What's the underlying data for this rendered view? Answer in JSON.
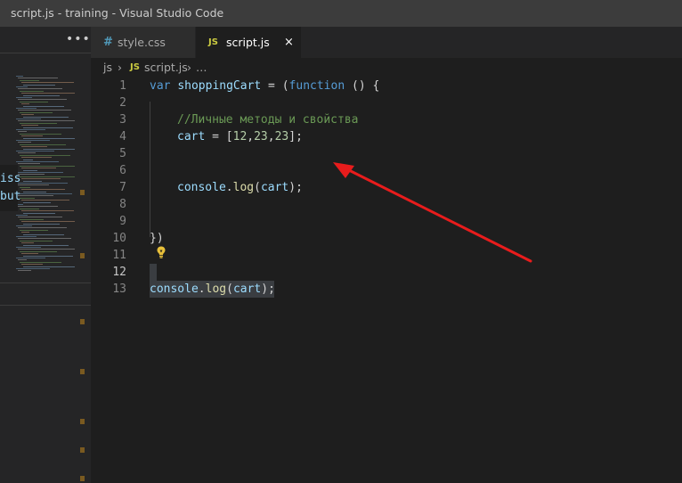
{
  "window": {
    "title": "script.js - training - Visual Studio Code"
  },
  "sidebar": {
    "more_label": "•••",
    "fragments": [
      "iss",
      "but"
    ]
  },
  "tabs": [
    {
      "icon": "#",
      "label": "style.css",
      "active": false
    },
    {
      "icon": "JS",
      "label": "script.js",
      "active": true,
      "close": "×"
    }
  ],
  "breadcrumb": {
    "folder": "js",
    "sep1": "›",
    "file_icon": "JS",
    "file": "script.js",
    "sep2": "›",
    "ellipsis": "…"
  },
  "editor": {
    "line_numbers": [
      "1",
      "2",
      "3",
      "4",
      "5",
      "6",
      "7",
      "8",
      "9",
      "10",
      "11",
      "12",
      "13"
    ],
    "current_line": "12",
    "lines": {
      "l1": {
        "kw1": "var",
        "name": "shoppingCart",
        "eq": " = (",
        "kw2": "function",
        "rest": " () {"
      },
      "l3": {
        "comment": "//Личные методы и свойства"
      },
      "l4": {
        "name": "cart",
        "eq": " = [",
        "n1": "12",
        "c1": ",",
        "n2": "23",
        "c2": ",",
        "n3": "23",
        "end": "];"
      },
      "l7": {
        "obj": "console",
        "dot": ".",
        "fn": "log",
        "open": "(",
        "arg": "cart",
        "close": ");"
      },
      "l10": {
        "text": "})"
      },
      "l13": {
        "obj": "console",
        "dot": ".",
        "fn": "log",
        "open": "(",
        "arg": "cart",
        "close": ");"
      }
    }
  },
  "colors": {
    "annotation_arrow": "#e81c1c",
    "keyword": "#569cd6",
    "comment": "#6a9955"
  }
}
